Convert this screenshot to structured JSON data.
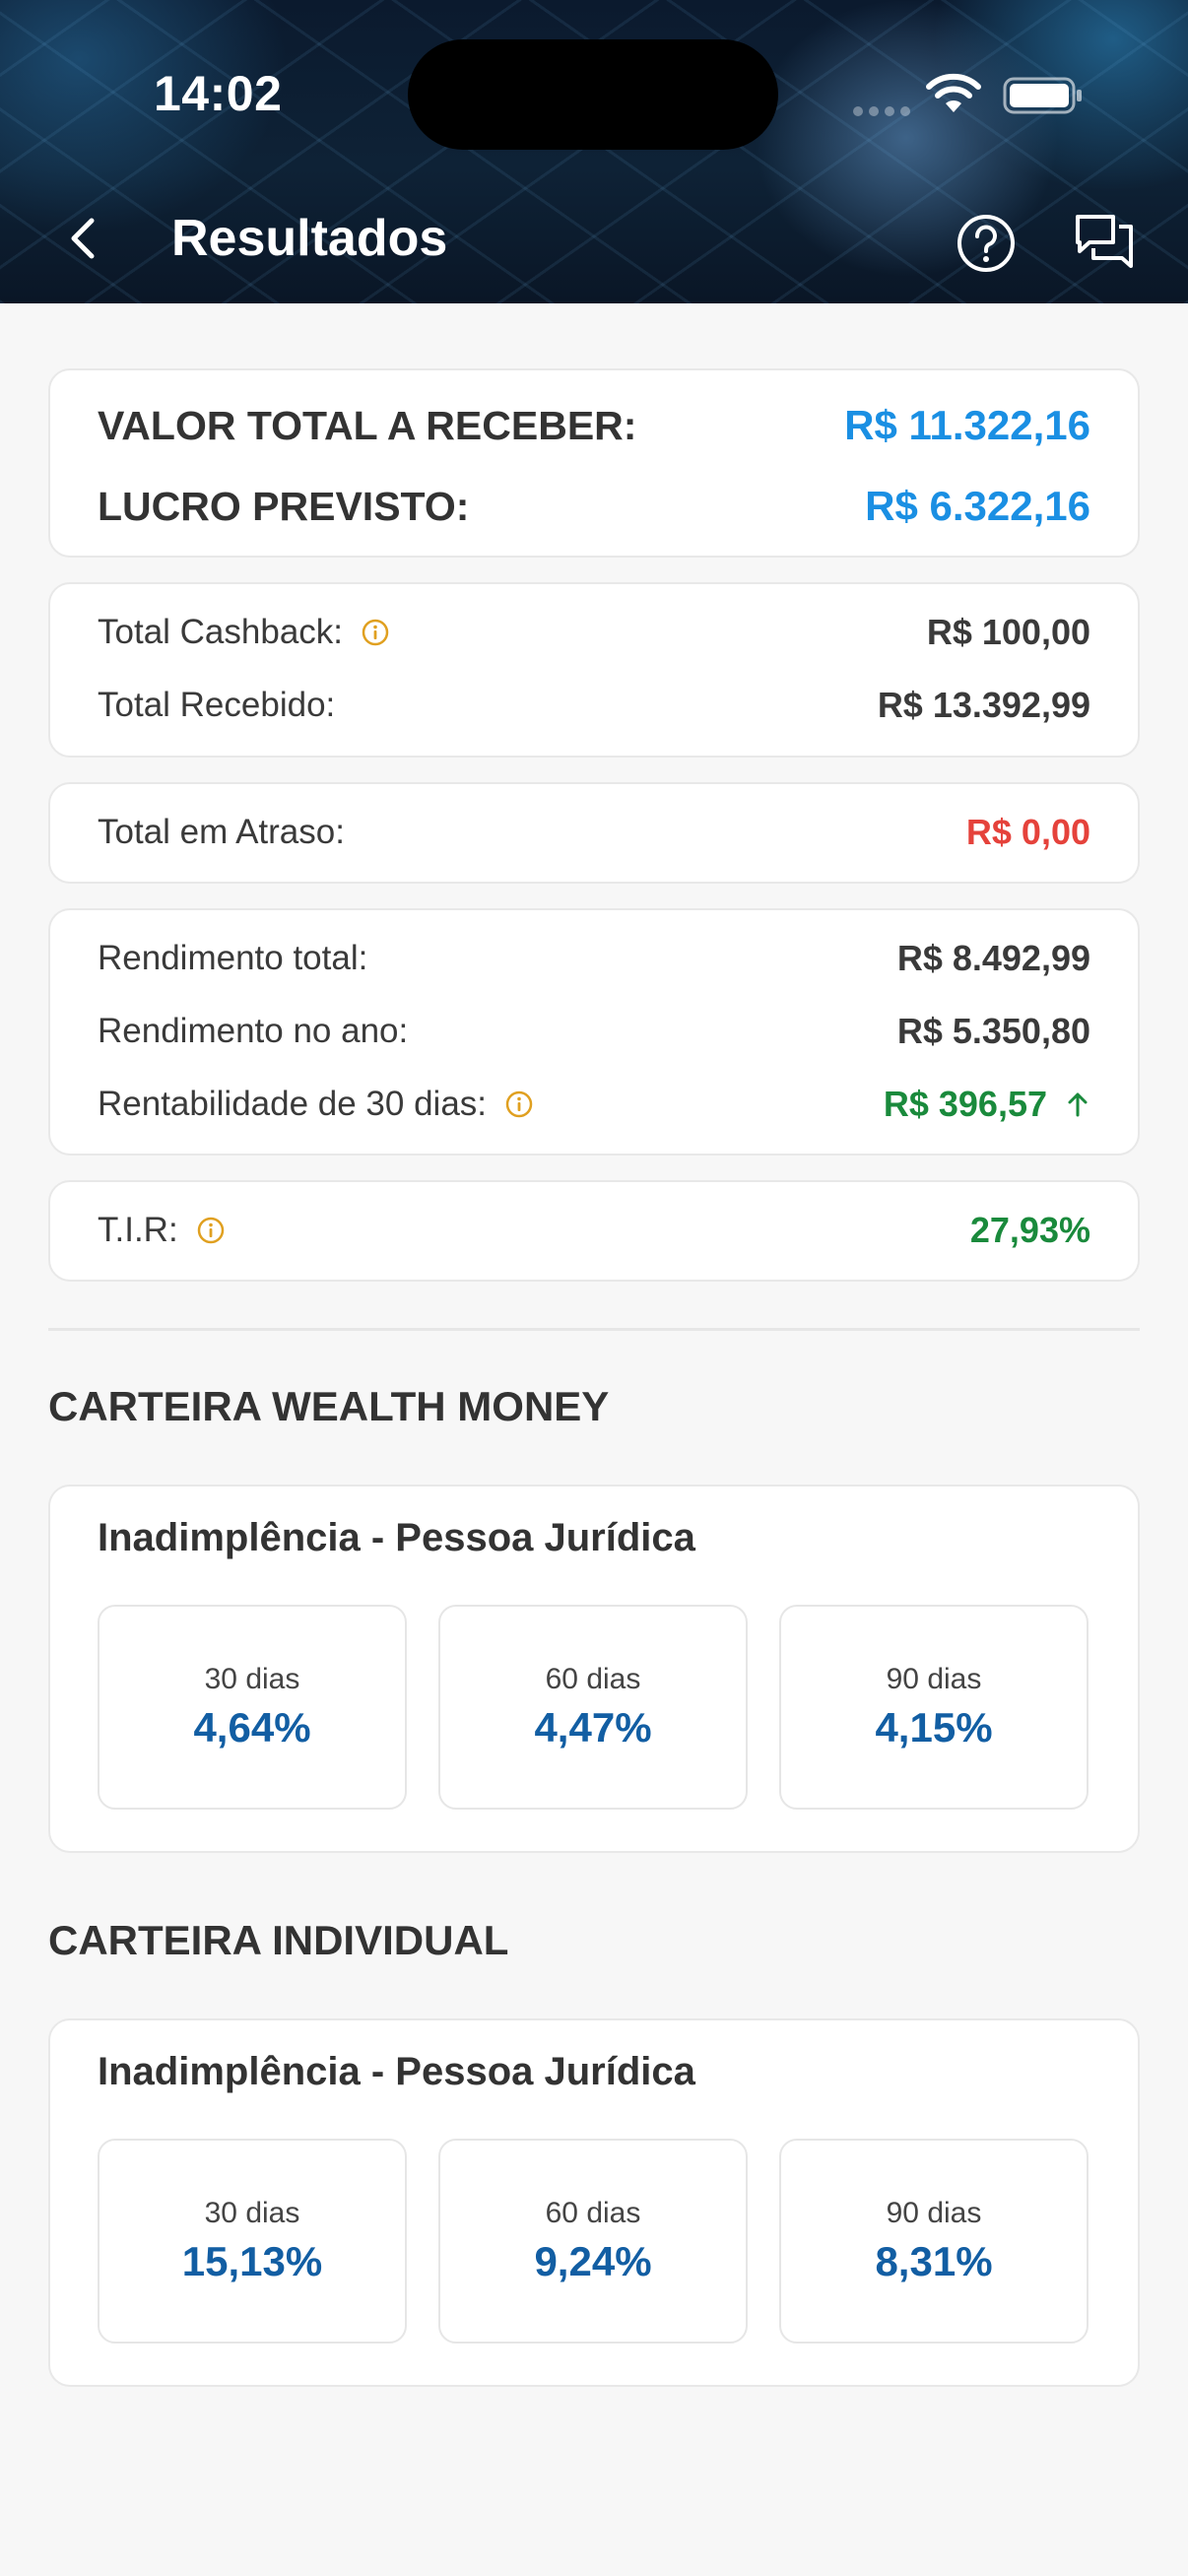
{
  "status_bar": {
    "time": "14:02"
  },
  "header": {
    "title": "Resultados"
  },
  "summary": {
    "total_label": "VALOR TOTAL A RECEBER:",
    "total_value": "R$ 11.322,16",
    "profit_label": "LUCRO PREVISTO:",
    "profit_value": "R$ 6.322,16"
  },
  "received": {
    "cashback_label": "Total Cashback:",
    "cashback_value": "R$ 100,00",
    "received_label": "Total Recebido:",
    "received_value": "R$ 13.392,99"
  },
  "late": {
    "label": "Total em Atraso:",
    "value": "R$ 0,00"
  },
  "yield": {
    "total_label": "Rendimento total:",
    "total_value": "R$ 8.492,99",
    "year_label": "Rendimento no ano:",
    "year_value": "R$ 5.350,80",
    "thirty_label": "Rentabilidade de 30 dias:",
    "thirty_value": "R$ 396,57"
  },
  "tir": {
    "label": "T.I.R:",
    "value": "27,93%"
  },
  "wealth_money": {
    "section_title": "CARTEIRA WEALTH MONEY",
    "card_title": "Inadimplência - Pessoa Jurídica",
    "periods": [
      {
        "label": "30 dias",
        "value": "4,64%"
      },
      {
        "label": "60 dias",
        "value": "4,47%"
      },
      {
        "label": "90 dias",
        "value": "4,15%"
      }
    ]
  },
  "individual": {
    "section_title": "CARTEIRA INDIVIDUAL",
    "card_title": "Inadimplência - Pessoa Jurídica",
    "periods": [
      {
        "label": "30 dias",
        "value": "15,13%"
      },
      {
        "label": "60 dias",
        "value": "9,24%"
      },
      {
        "label": "90 dias",
        "value": "8,31%"
      }
    ]
  },
  "colors": {
    "accent_blue": "#1a8fe3",
    "percent_blue": "#125ea3",
    "negative_red": "#e5423b",
    "positive_green": "#1a8a3c",
    "info_yellow": "#e0a020"
  },
  "icons": [
    "back-chevron-icon",
    "help-circle-icon",
    "chat-icon",
    "info-icon",
    "arrow-up-icon",
    "wifi-icon",
    "battery-icon"
  ]
}
